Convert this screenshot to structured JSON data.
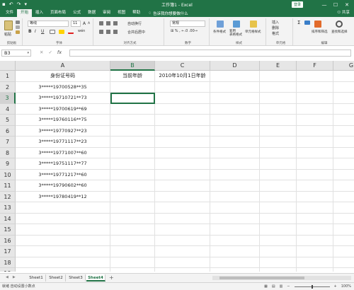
{
  "window": {
    "title": "工作簿1 - Excel",
    "login_label": "登录",
    "controls": [
      "—",
      "☐",
      "✕"
    ],
    "qat": [
      "▪",
      "↶",
      "↷",
      "▾"
    ]
  },
  "ribbon_tabs": {
    "items": [
      "文件",
      "开始",
      "插入",
      "页面布局",
      "公式",
      "数据",
      "审阅",
      "视图",
      "帮助"
    ],
    "active_index": 1,
    "tell_me": "告诉我你想要做什么",
    "share": "共享"
  },
  "ribbon": {
    "clipboard": {
      "label": "剪贴板",
      "paste": "粘贴"
    },
    "font": {
      "label": "字体",
      "name": "等线",
      "size": "11",
      "bold": "B",
      "italic": "I",
      "underline": "U",
      "grow": "A",
      "shrink": "A",
      "wen": "wén"
    },
    "alignment": {
      "label": "对齐方式",
      "wrap": "自动换行",
      "merge": "合并后居中"
    },
    "number": {
      "label": "数字",
      "format": "常规"
    },
    "styles": {
      "label": "样式",
      "conditional": "条件格式",
      "table": "套用\n表格格式",
      "cell": "单元格样式"
    },
    "cells": {
      "label": "单元格",
      "insert": "插入",
      "delete": "删除",
      "format": "格式"
    },
    "editing": {
      "label": "编辑",
      "sort": "排序和筛选",
      "find": "查找和选择"
    }
  },
  "formula_bar": {
    "name_box": "B3",
    "formula": "",
    "icons": [
      "✕",
      "✓",
      "fx"
    ]
  },
  "grid": {
    "columns": [
      "A",
      "B",
      "C",
      "D",
      "E",
      "F",
      "G"
    ],
    "selected_column": "B",
    "selected_row": 3,
    "row_numbers": [
      "1",
      "2",
      "3",
      "4",
      "5",
      "6",
      "7",
      "8",
      "9",
      "10",
      "11",
      "12",
      "13",
      "14",
      "15",
      "16",
      "17",
      "18",
      "19"
    ],
    "header_row": {
      "A": "身份证号码",
      "B": "当前年龄",
      "C": "2010年10月1日年龄"
    },
    "id_values": [
      "3*****19700528**35",
      "3*****19710721**73",
      "3*****19700619**69",
      "3*****19760116**75",
      "3*****19770927**23",
      "3*****19771117**23",
      "3*****19771007**60",
      "3*****19751117**77",
      "3*****19771217**60",
      "3*****19790602**60",
      "3*****19780419**12"
    ]
  },
  "sheets": {
    "tabs": [
      "Sheet1",
      "Sheet2",
      "Sheet3",
      "Sheet4"
    ],
    "active": "Sheet4",
    "add_label": "+"
  },
  "status_bar": {
    "left": "就绪    自动设置小数点",
    "zoom": "100%"
  },
  "colors": {
    "accent": "#217346"
  }
}
